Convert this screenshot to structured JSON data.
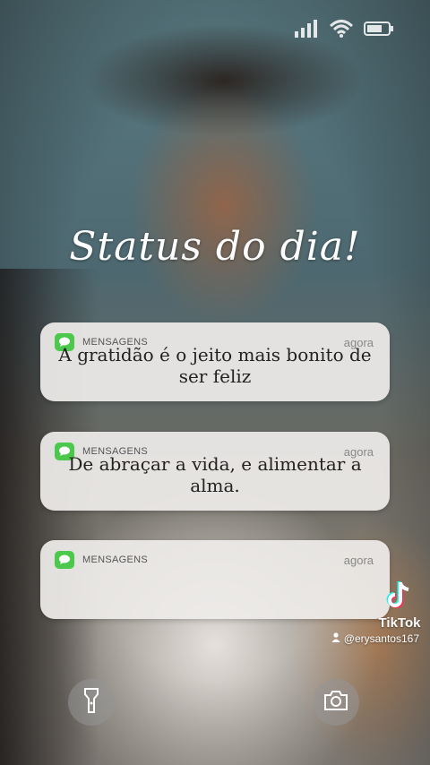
{
  "title": "Status do dia!",
  "notifications": [
    {
      "app": "MENSAGENS",
      "time": "agora",
      "message": "A gratidão é o jeito mais bonito de ser feliz"
    },
    {
      "app": "MENSAGENS",
      "time": "agora",
      "message": "De abraçar a vida, e alimentar a alma."
    },
    {
      "app": "MENSAGENS",
      "time": "agora",
      "message": ""
    }
  ],
  "status_icons": [
    "signal-icon",
    "wifi-icon",
    "battery-icon"
  ],
  "bottom_buttons": [
    "flashlight-icon",
    "camera-icon"
  ],
  "watermark": {
    "brand": "TikTok",
    "handle": "@erysantos167"
  },
  "colors": {
    "app_icon": "#4cc94c",
    "card_bg": "#eeeceа"
  }
}
